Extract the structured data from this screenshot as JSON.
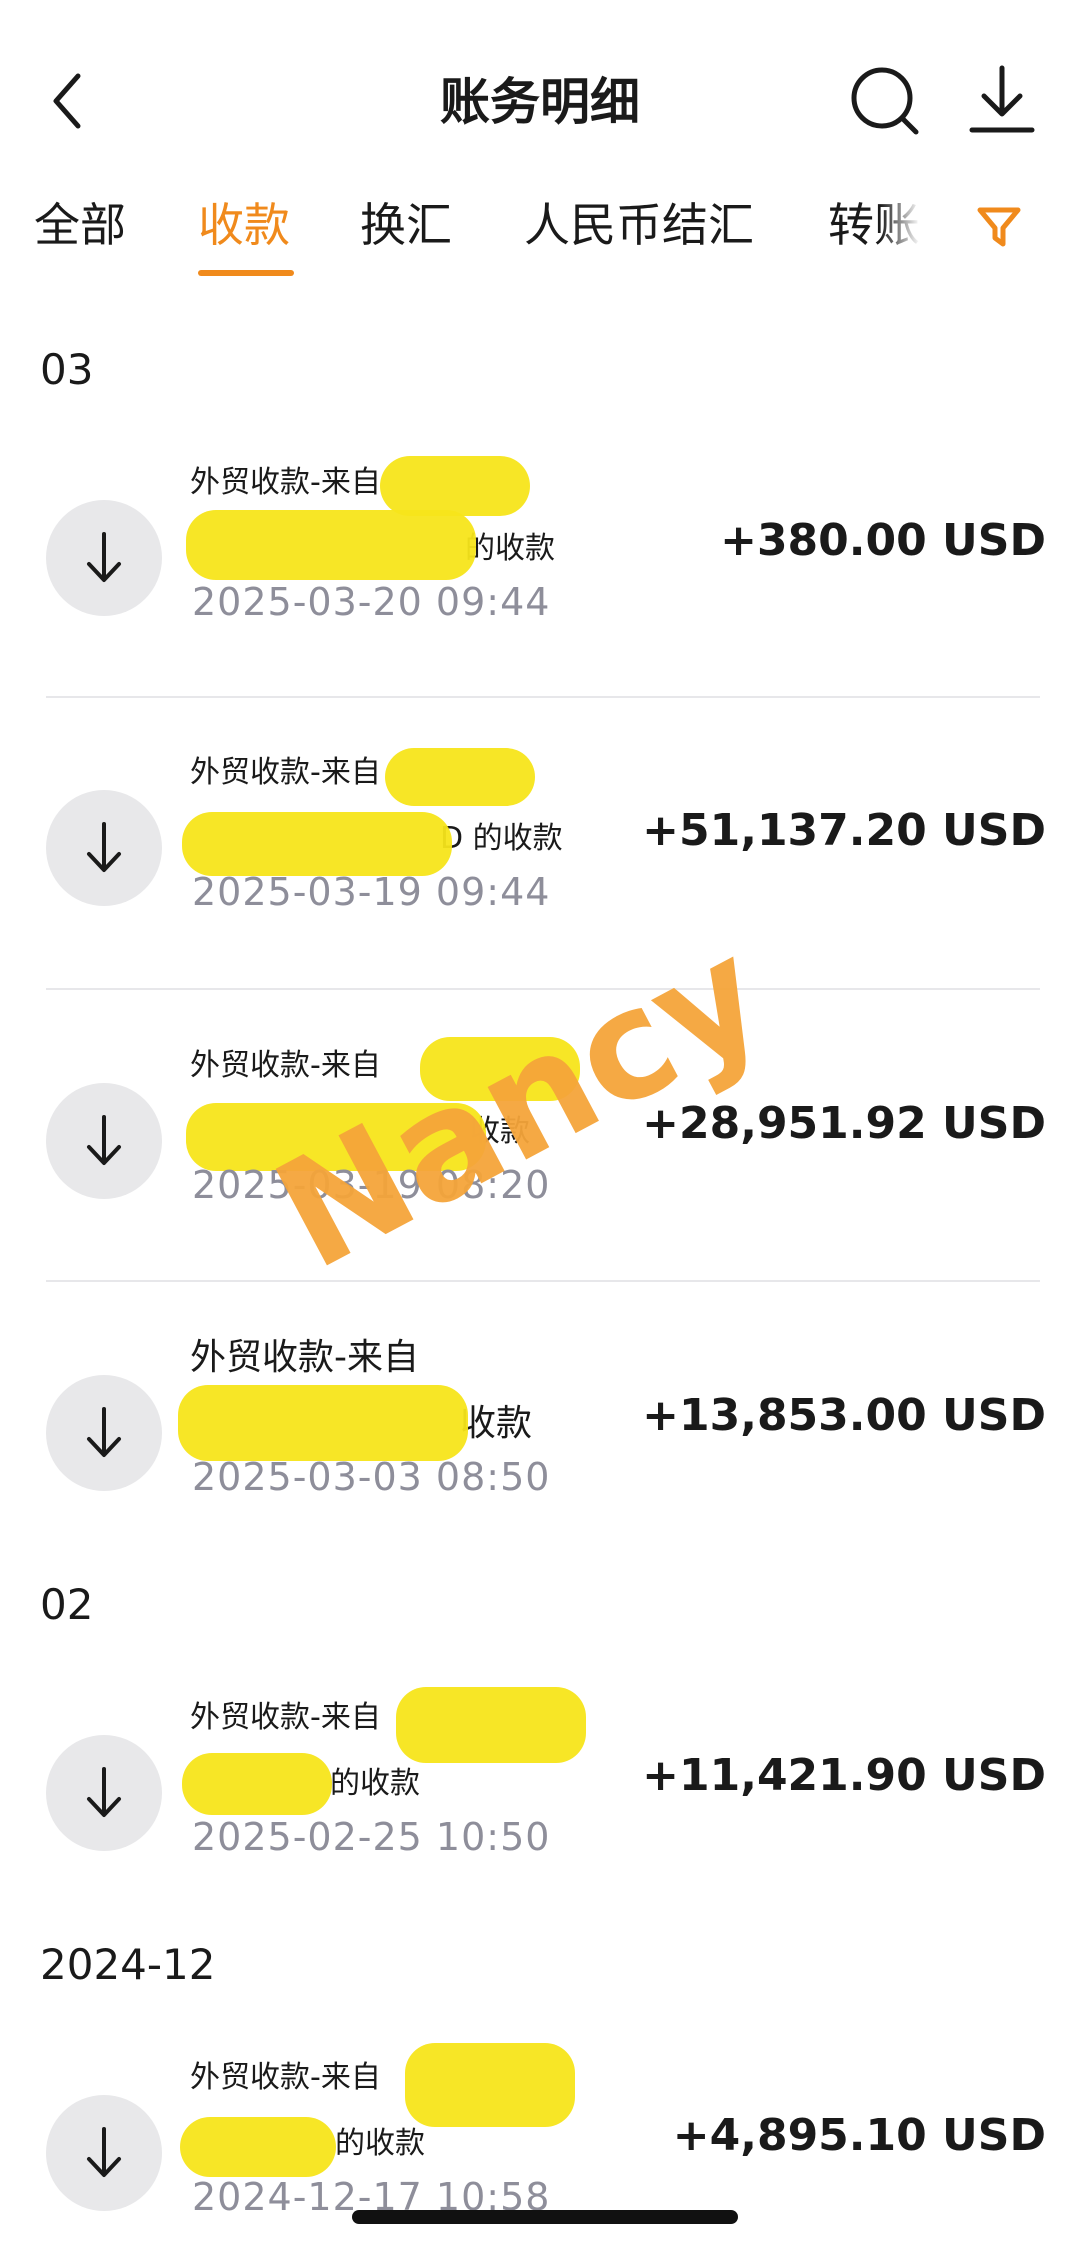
{
  "header": {
    "title": "账务明细",
    "back_icon": "back-chevron-icon",
    "search_icon": "search-icon",
    "download_icon": "download-icon"
  },
  "tabs": [
    {
      "label": "全部",
      "active": false
    },
    {
      "label": "收款",
      "active": true
    },
    {
      "label": "换汇",
      "active": false
    },
    {
      "label": "人民币结汇",
      "active": false
    },
    {
      "label": "转账",
      "active": false
    }
  ],
  "filter_icon": "filter-icon",
  "accent_color": "#f08a1c",
  "sections": [
    {
      "title": "03",
      "transactions": [
        {
          "desc_prefix": "外贸收款-来自",
          "desc_suffix": "的收款",
          "date": "2025-03-20 09:44",
          "amount": "+380.00 USD"
        },
        {
          "desc_prefix": "外贸收款-来自",
          "desc_suffix": "D 的收款",
          "date": "2025-03-19 09:44",
          "amount": "+51,137.20 USD"
        },
        {
          "desc_prefix": "外贸收款-来自",
          "desc_suffix": "收款",
          "date": "2025-03-19 08:20",
          "amount": "+28,951.92 USD"
        },
        {
          "desc_prefix": "外贸收款-来自",
          "desc_suffix": "收款",
          "date": "2025-03-03 08:50",
          "amount": "+13,853.00 USD"
        }
      ]
    },
    {
      "title": "02",
      "transactions": [
        {
          "desc_prefix": "外贸收款-来自",
          "desc_suffix": "的收款",
          "date": "2025-02-25 10:50",
          "amount": "+11,421.90 USD"
        }
      ]
    },
    {
      "title": "2024-12",
      "transactions": [
        {
          "desc_prefix": "外贸收款-来自",
          "desc_suffix": "的收款",
          "date": "2024-12-17 10:58",
          "amount": "+4,895.10 USD"
        }
      ]
    }
  ],
  "watermark": "Nancy"
}
